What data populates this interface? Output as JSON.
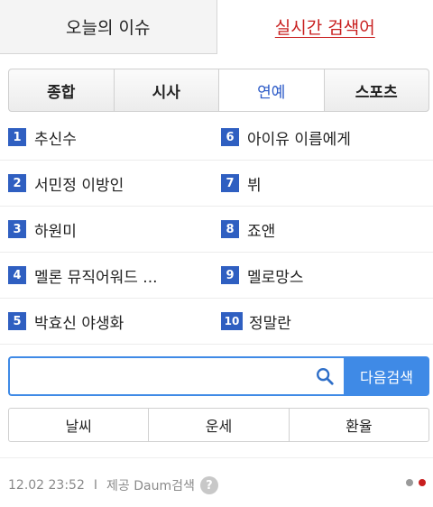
{
  "top_tabs": {
    "issues": "오늘의 이슈",
    "realtime": "실시간 검색어"
  },
  "category_tabs": [
    "종합",
    "시사",
    "연예",
    "스포츠"
  ],
  "active_category": "연예",
  "rankings": [
    {
      "rank": "1",
      "keyword": "추신수"
    },
    {
      "rank": "2",
      "keyword": "서민정 이방인"
    },
    {
      "rank": "3",
      "keyword": "하원미"
    },
    {
      "rank": "4",
      "keyword": "멜론 뮤직어워드 ..."
    },
    {
      "rank": "5",
      "keyword": "박효신 야생화"
    },
    {
      "rank": "6",
      "keyword": "아이유 이름에게"
    },
    {
      "rank": "7",
      "keyword": "뷔"
    },
    {
      "rank": "8",
      "keyword": "죠앤"
    },
    {
      "rank": "9",
      "keyword": "멜로망스"
    },
    {
      "rank": "10",
      "keyword": "정말란"
    }
  ],
  "search": {
    "placeholder": "",
    "value": "",
    "button_label": "다음검색",
    "icon": "search-icon"
  },
  "quick_links": [
    "날씨",
    "운세",
    "환율"
  ],
  "footer": {
    "timestamp": "12.02 23:52",
    "separator": "I",
    "provider": "제공 Daum검색",
    "help": "?"
  },
  "colors": {
    "accent_blue": "#2f5fc1",
    "search_blue": "#3f8ae6",
    "realtime_red": "#c81f1f",
    "dot_inactive": "#9a9a9a",
    "dot_active": "#c81f1f"
  }
}
